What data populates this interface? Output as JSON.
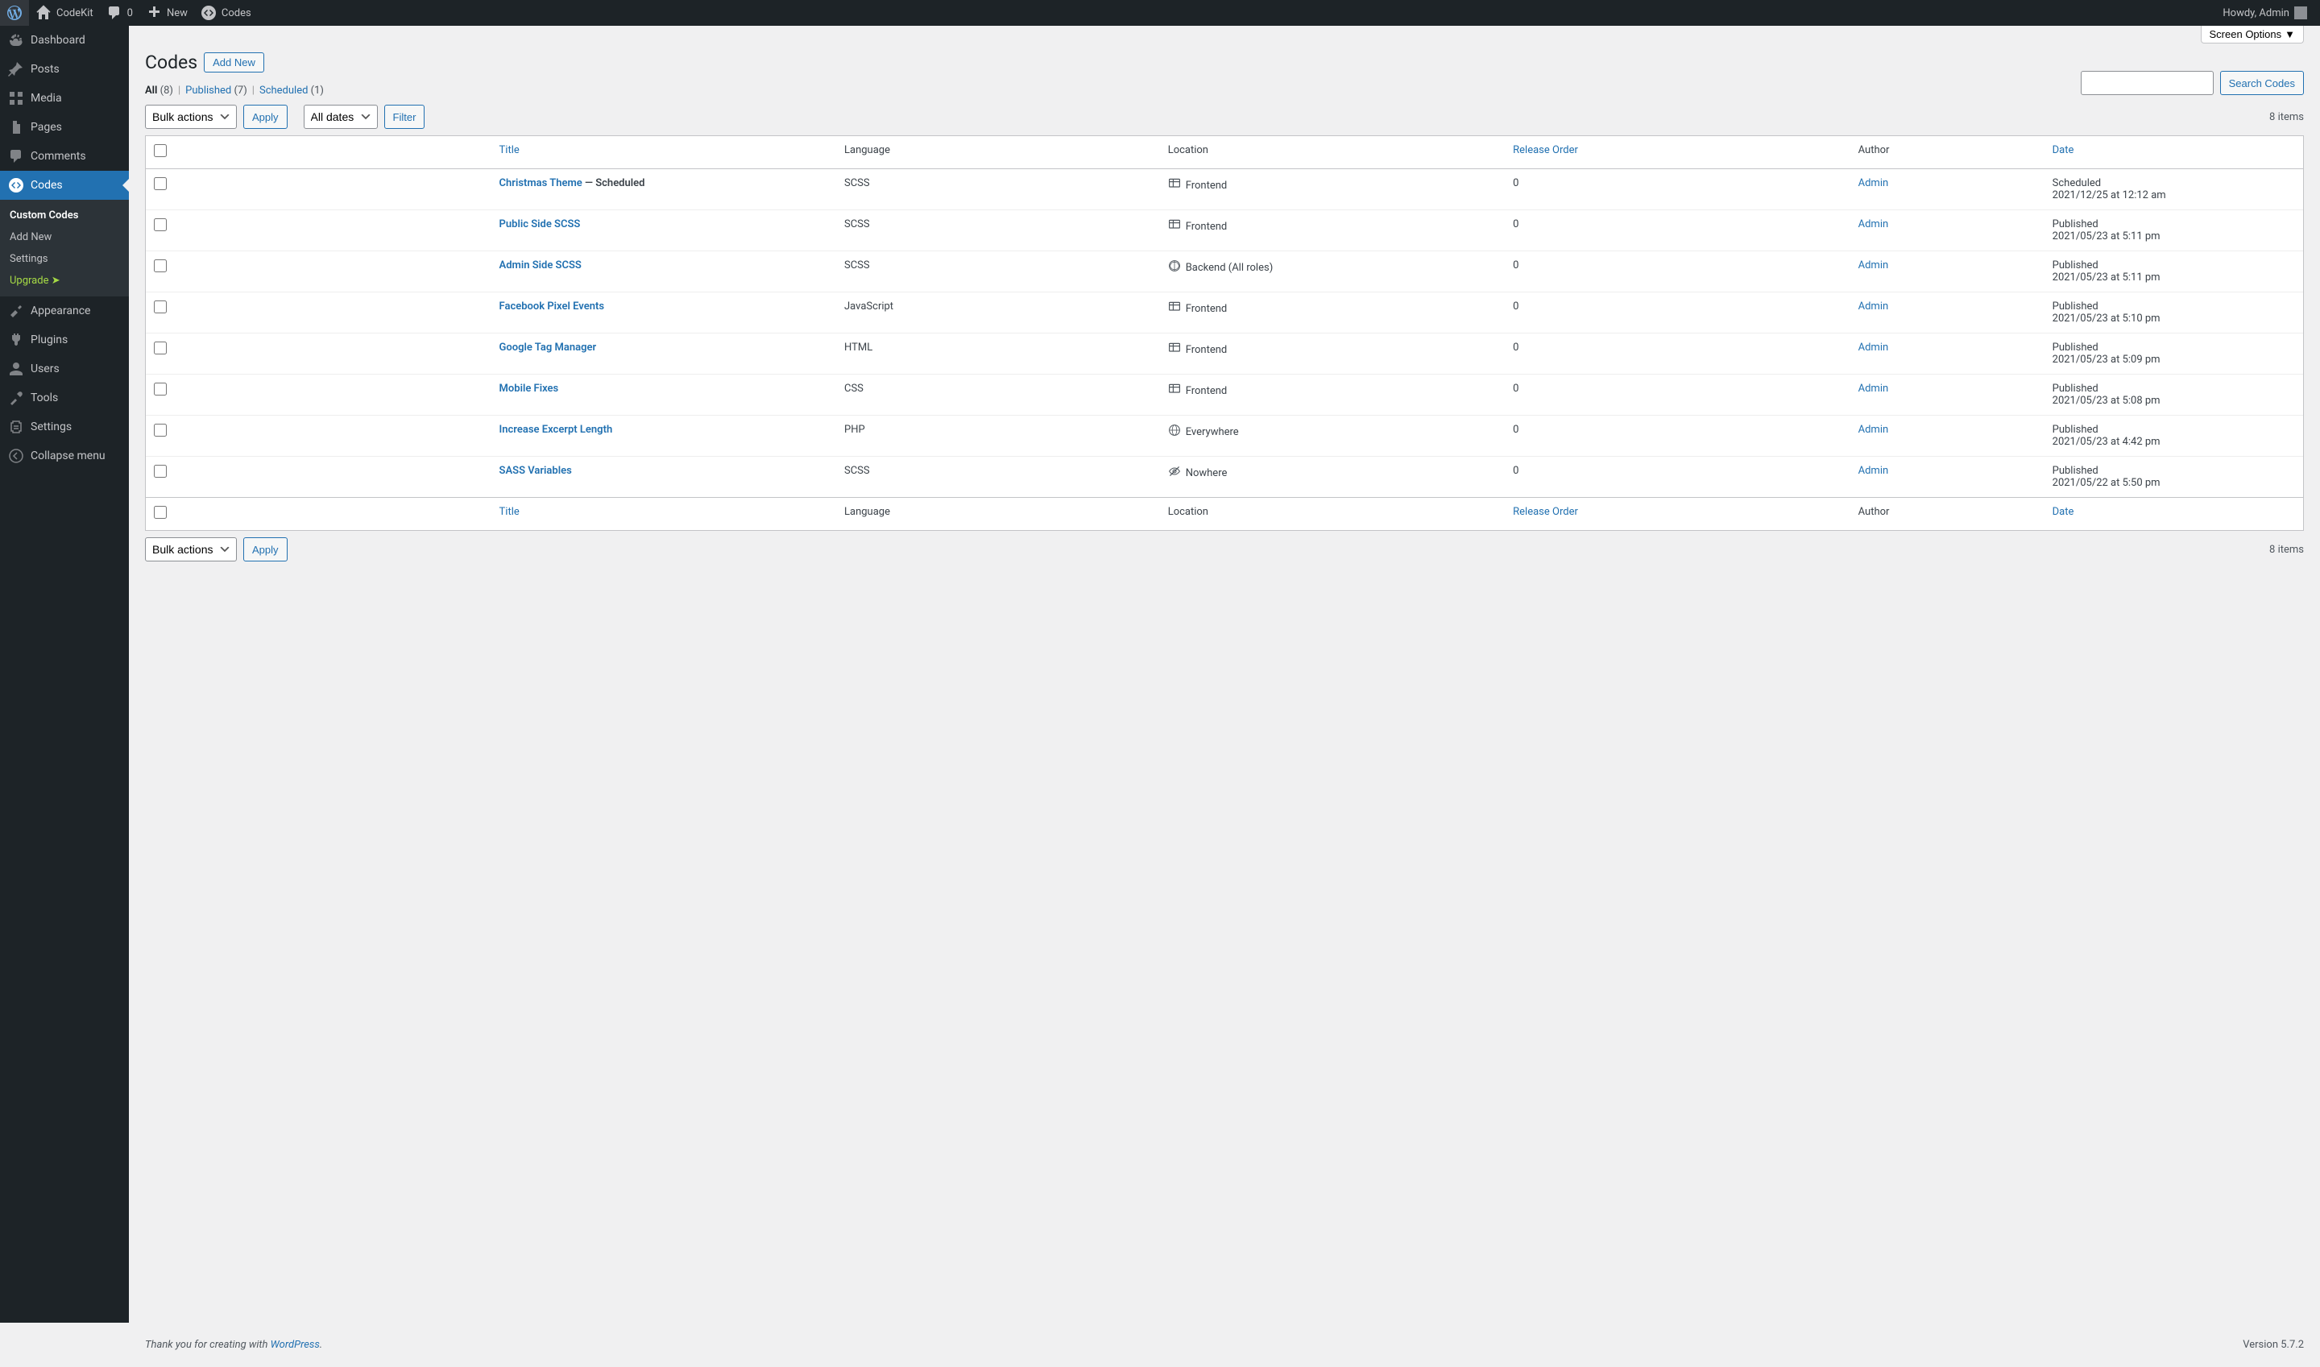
{
  "adminbar": {
    "site_name": "CodeKit",
    "comments_count": "0",
    "new_label": "New",
    "codes_label": "Codes",
    "howdy": "Howdy, Admin"
  },
  "sidebar": {
    "items": [
      {
        "label": "Dashboard"
      },
      {
        "label": "Posts"
      },
      {
        "label": "Media"
      },
      {
        "label": "Pages"
      },
      {
        "label": "Comments"
      },
      {
        "label": "Codes"
      },
      {
        "label": "Appearance"
      },
      {
        "label": "Plugins"
      },
      {
        "label": "Users"
      },
      {
        "label": "Tools"
      },
      {
        "label": "Settings"
      },
      {
        "label": "Collapse menu"
      }
    ],
    "submenu": {
      "custom_codes": "Custom Codes",
      "add_new": "Add New",
      "settings": "Settings",
      "upgrade": "Upgrade  ➤"
    }
  },
  "screen_options_label": "Screen Options",
  "page": {
    "title": "Codes",
    "add_new_label": "Add New"
  },
  "filters": {
    "all_label": "All",
    "all_count": "(8)",
    "published_label": "Published",
    "published_count": "(7)",
    "scheduled_label": "Scheduled",
    "scheduled_count": "(1)"
  },
  "search": {
    "button": "Search Codes"
  },
  "bulk": {
    "select": "Bulk actions",
    "apply": "Apply"
  },
  "date_filter": {
    "select": "All dates",
    "button": "Filter"
  },
  "items_count": "8 items",
  "columns": {
    "title": "Title",
    "language": "Language",
    "location": "Location",
    "release_order": "Release Order",
    "author": "Author",
    "date": "Date"
  },
  "rows": [
    {
      "title": "Christmas Theme",
      "state": " — Scheduled",
      "language": "SCSS",
      "location": "Frontend",
      "loc_icon": "frontend",
      "release": "0",
      "author": "Admin",
      "status": "Scheduled",
      "datetime": "2021/12/25 at 12:12 am"
    },
    {
      "title": "Public Side SCSS",
      "state": "",
      "language": "SCSS",
      "location": "Frontend",
      "loc_icon": "frontend",
      "release": "0",
      "author": "Admin",
      "status": "Published",
      "datetime": "2021/05/23 at 5:11 pm"
    },
    {
      "title": "Admin Side SCSS",
      "state": "",
      "language": "SCSS",
      "location": "Backend (All roles)",
      "loc_icon": "backend",
      "release": "0",
      "author": "Admin",
      "status": "Published",
      "datetime": "2021/05/23 at 5:11 pm"
    },
    {
      "title": "Facebook Pixel Events",
      "state": "",
      "language": "JavaScript",
      "location": "Frontend",
      "loc_icon": "frontend",
      "release": "0",
      "author": "Admin",
      "status": "Published",
      "datetime": "2021/05/23 at 5:10 pm"
    },
    {
      "title": "Google Tag Manager",
      "state": "",
      "language": "HTML",
      "location": "Frontend",
      "loc_icon": "frontend",
      "release": "0",
      "author": "Admin",
      "status": "Published",
      "datetime": "2021/05/23 at 5:09 pm"
    },
    {
      "title": "Mobile Fixes",
      "state": "",
      "language": "CSS",
      "location": "Frontend",
      "loc_icon": "frontend",
      "release": "0",
      "author": "Admin",
      "status": "Published",
      "datetime": "2021/05/23 at 5:08 pm"
    },
    {
      "title": "Increase Excerpt Length",
      "state": "",
      "language": "PHP",
      "location": "Everywhere",
      "loc_icon": "globe",
      "release": "0",
      "author": "Admin",
      "status": "Published",
      "datetime": "2021/05/23 at 4:42 pm"
    },
    {
      "title": "SASS Variables",
      "state": "",
      "language": "SCSS",
      "location": "Nowhere",
      "loc_icon": "nowhere",
      "release": "0",
      "author": "Admin",
      "status": "Published",
      "datetime": "2021/05/22 at 5:50 pm"
    }
  ],
  "footer": {
    "thanks_prefix": "Thank you for creating with ",
    "wp_link": "WordPress",
    "thanks_suffix": ".",
    "version": "Version 5.7.2"
  }
}
